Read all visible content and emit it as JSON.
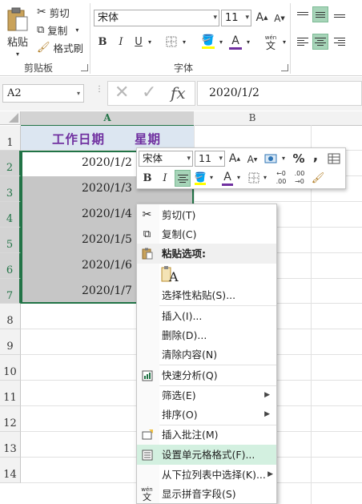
{
  "ribbon": {
    "clipboard": {
      "paste": "粘贴",
      "cut": "剪切",
      "copy": "复制",
      "format_painter": "格式刷",
      "group_label": "剪贴板"
    },
    "font": {
      "font_name": "宋体",
      "font_size": "11",
      "bold": "B",
      "italic": "I",
      "underline": "U",
      "group_label": "字体",
      "grow": "A",
      "shrink": "A",
      "wen_top": "wén",
      "wen_char": "文",
      "font_color_glyph": "A"
    }
  },
  "formula_bar": {
    "name_box": "A2",
    "fx": "fx",
    "value": "2020/1/2"
  },
  "grid": {
    "columns": [
      "A",
      "B"
    ],
    "rows": [
      "1",
      "2",
      "3",
      "4",
      "5",
      "6",
      "7",
      "8",
      "9",
      "10",
      "11",
      "12",
      "13",
      "14"
    ],
    "header_a1": "工作日期",
    "header_b1": "星期",
    "dates": [
      "2020/1/2",
      "2020/1/3",
      "2020/1/4",
      "2020/1/5",
      "2020/1/6",
      "2020/1/7"
    ]
  },
  "mini_toolbar": {
    "font_name": "宋体",
    "font_size": "11",
    "bold": "B",
    "italic": "I",
    "percent": "%",
    "comma": ",",
    "grow": "A",
    "shrink": "A",
    "font_color_glyph": "A",
    "inc_decimal_top": "←0",
    "inc_decimal_bottom": ".00",
    "dec_decimal_top": ".00",
    "dec_decimal_bottom": "→0"
  },
  "context_menu": {
    "items": [
      {
        "label": "剪切(T)"
      },
      {
        "label": "复制(C)"
      },
      {
        "label": "粘贴选项:"
      },
      {
        "label": "选择性粘贴(S)..."
      },
      {
        "label": "插入(I)..."
      },
      {
        "label": "删除(D)..."
      },
      {
        "label": "清除内容(N)"
      },
      {
        "label": "快速分析(Q)"
      },
      {
        "label": "筛选(E)"
      },
      {
        "label": "排序(O)"
      },
      {
        "label": "插入批注(M)"
      },
      {
        "label": "设置单元格格式(F)..."
      },
      {
        "label": "从下拉列表中选择(K)..."
      },
      {
        "label": "显示拼音字段(S)"
      }
    ],
    "paste_icon_letter": "A",
    "wen_top": "wén",
    "wen_char": "文"
  },
  "colors": {
    "accent_green": "#217346",
    "header_blue_fill": "#dce6f1",
    "header_text": "#7030a0",
    "selection_gray": "#c6c6c6",
    "highlight_green": "#d3f0e0"
  }
}
